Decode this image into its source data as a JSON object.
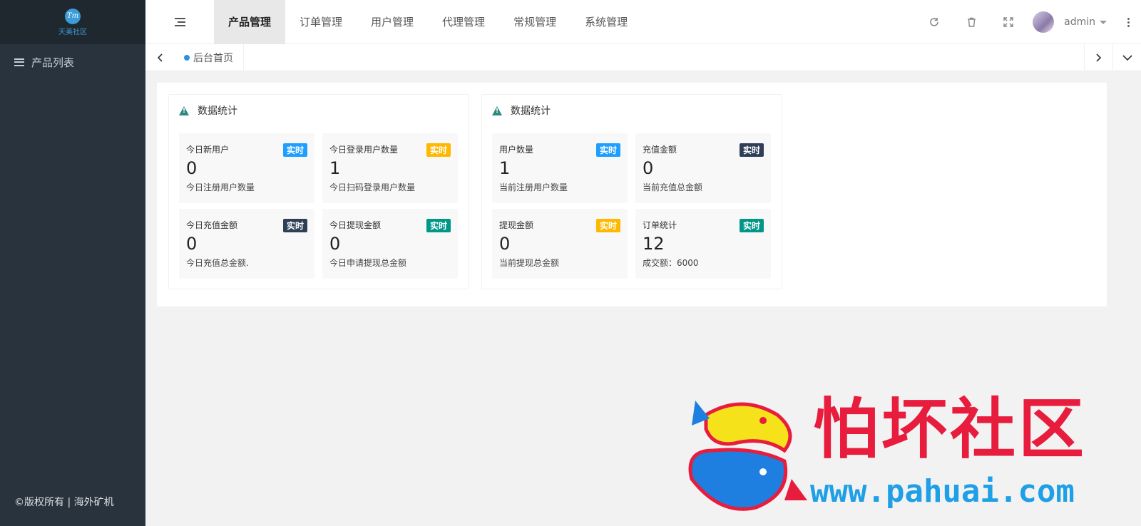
{
  "sidebar": {
    "logo_text": "天美社区",
    "logo_mark": "Tm",
    "items": [
      {
        "label": "产品列表",
        "icon": "list-icon"
      }
    ],
    "copyright": "©版权所有 | 海外矿机"
  },
  "header": {
    "tabs": [
      {
        "label": "产品管理",
        "active": true
      },
      {
        "label": "订单管理",
        "active": false
      },
      {
        "label": "用户管理",
        "active": false
      },
      {
        "label": "代理管理",
        "active": false
      },
      {
        "label": "常规管理",
        "active": false
      },
      {
        "label": "系统管理",
        "active": false
      }
    ],
    "icons": [
      "refresh-icon",
      "trash-icon",
      "fullscreen-icon"
    ],
    "user": {
      "name": "admin"
    }
  },
  "tabsbar": {
    "home_tab": "后台首页"
  },
  "cards": [
    {
      "title": "数据统计",
      "stats": [
        {
          "label": "今日新用户",
          "badge": "实时",
          "badge_color": "#1e9fff",
          "value": "0",
          "desc": "今日注册用户数量"
        },
        {
          "label": "今日登录用户数量",
          "badge": "实时",
          "badge_color": "#ffb800",
          "value": "1",
          "desc": "今日扫码登录用户数量"
        },
        {
          "label": "今日充值金额",
          "badge": "实时",
          "badge_color": "#2f4056",
          "value": "0",
          "desc": "今日充值总金额."
        },
        {
          "label": "今日提现金额",
          "badge": "实时",
          "badge_color": "#009688",
          "value": "0",
          "desc": "今日申请提现总金额"
        }
      ]
    },
    {
      "title": "数据统计",
      "stats": [
        {
          "label": "用户数量",
          "badge": "实时",
          "badge_color": "#1e9fff",
          "value": "1",
          "desc": "当前注册用户数量"
        },
        {
          "label": "充值金额",
          "badge": "实时",
          "badge_color": "#2f4056",
          "value": "0",
          "desc": "当前充值总金额"
        },
        {
          "label": "提现金额",
          "badge": "实时",
          "badge_color": "#ffb800",
          "value": "0",
          "desc": "当前提现总金额"
        },
        {
          "label": "订单统计",
          "badge": "实时",
          "badge_color": "#009688",
          "value": "12",
          "desc": "成交额：6000"
        }
      ]
    }
  ],
  "watermark": {
    "title": "怕坏社区",
    "url": "www.pahuai.com"
  }
}
